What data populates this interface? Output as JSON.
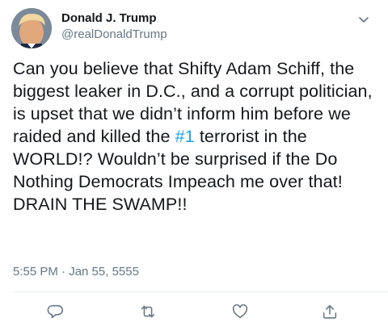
{
  "author": {
    "display_name": "Donald J. Trump",
    "handle": "@realDonaldTrump"
  },
  "tweet": {
    "text_before": "Can you believe that Shifty Adam Schiff, the biggest leaker in D.C., and a corrupt politician, is upset that we didn’t inform him before we raided and killed the ",
    "hashtag": "#1",
    "text_after": " terrorist in the WORLD!? Wouldn’t be surprised if the Do Nothing Democrats Impeach me over that! DRAIN THE SWAMP!!",
    "timestamp": "5:55 PM · Jan 55, 5555"
  },
  "icons": {
    "caret": "chevron-down-icon",
    "reply": "reply-icon",
    "retweet": "retweet-icon",
    "like": "heart-icon",
    "share": "share-icon"
  },
  "colors": {
    "text": "#14171a",
    "secondary": "#657786",
    "link": "#1da1f2",
    "icon": "#657786",
    "divider": "#e6ecf0"
  }
}
